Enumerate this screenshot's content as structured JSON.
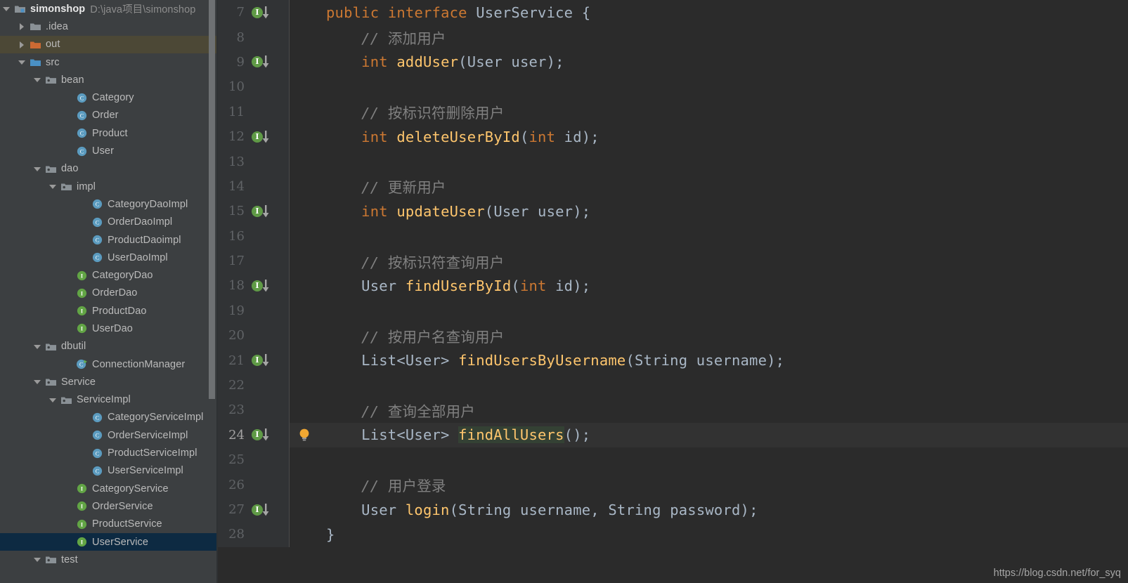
{
  "theme": {
    "sidebar_bg": "#3c3f41",
    "editor_bg": "#2b2b2b",
    "gutter_bg": "#313335",
    "selection_bg": "#0d2a42",
    "hover_bg": "#4c4836",
    "caret_row_bg": "#323232",
    "keyword_color": "#cc7832",
    "method_color": "#ffc66d",
    "type_color": "#a9b7c6",
    "comment_color": "#808080",
    "identifier_highlight_bg": "#344134",
    "impl_marker_green": "#5f9a46",
    "bulb_amber": "#f0a732",
    "interface_icon_green": "#62a545",
    "class_icon_blue": "#5b9bbf",
    "folder_icon_gray": "#8a9196",
    "folder_icon_orange": "#cc6a33",
    "module_icon_blue": "#4a90c4"
  },
  "sidebar": {
    "project_name": "simonshop",
    "project_path": "D:\\java项目\\simonshop",
    "scrollbar": {
      "thumb_top": 0,
      "thumb_height": 568
    },
    "items": [
      {
        "label": "simonshop",
        "path": "D:\\java项目\\simonshop",
        "indent": 0,
        "twisty": "down",
        "icon": "module-icon",
        "state": "normal",
        "bold": true
      },
      {
        "label": ".idea",
        "indent": 1,
        "twisty": "right",
        "icon": "folder-icon",
        "state": "normal"
      },
      {
        "label": "out",
        "indent": 1,
        "twisty": "right",
        "icon": "folder-orange-icon",
        "state": "hover"
      },
      {
        "label": "src",
        "indent": 1,
        "twisty": "down",
        "icon": "folder-source-icon",
        "state": "normal"
      },
      {
        "label": "bean",
        "indent": 2,
        "twisty": "down",
        "icon": "package-icon",
        "state": "normal"
      },
      {
        "label": "Category",
        "indent": 4,
        "twisty": "none",
        "icon": "class-icon",
        "state": "normal"
      },
      {
        "label": "Order",
        "indent": 4,
        "twisty": "none",
        "icon": "class-icon",
        "state": "normal"
      },
      {
        "label": "Product",
        "indent": 4,
        "twisty": "none",
        "icon": "class-icon",
        "state": "normal"
      },
      {
        "label": "User",
        "indent": 4,
        "twisty": "none",
        "icon": "class-icon",
        "state": "normal"
      },
      {
        "label": "dao",
        "indent": 2,
        "twisty": "down",
        "icon": "package-icon",
        "state": "normal"
      },
      {
        "label": "impl",
        "indent": 3,
        "twisty": "down",
        "icon": "package-icon",
        "state": "normal"
      },
      {
        "label": "CategoryDaoImpl",
        "indent": 5,
        "twisty": "none",
        "icon": "class-icon",
        "state": "normal"
      },
      {
        "label": "OrderDaoImpl",
        "indent": 5,
        "twisty": "none",
        "icon": "class-icon",
        "state": "normal"
      },
      {
        "label": "ProductDaoimpl",
        "indent": 5,
        "twisty": "none",
        "icon": "class-icon",
        "state": "normal"
      },
      {
        "label": "UserDaoImpl",
        "indent": 5,
        "twisty": "none",
        "icon": "class-icon",
        "state": "normal"
      },
      {
        "label": "CategoryDao",
        "indent": 4,
        "twisty": "none",
        "icon": "interface-icon",
        "state": "normal"
      },
      {
        "label": "OrderDao",
        "indent": 4,
        "twisty": "none",
        "icon": "interface-icon",
        "state": "normal"
      },
      {
        "label": "ProductDao",
        "indent": 4,
        "twisty": "none",
        "icon": "interface-icon",
        "state": "normal"
      },
      {
        "label": "UserDao",
        "indent": 4,
        "twisty": "none",
        "icon": "interface-icon",
        "state": "normal"
      },
      {
        "label": "dbutil",
        "indent": 2,
        "twisty": "down",
        "icon": "package-icon",
        "state": "normal"
      },
      {
        "label": "ConnectionManager",
        "indent": 4,
        "twisty": "none",
        "icon": "class-runnable-icon",
        "state": "normal"
      },
      {
        "label": "Service",
        "indent": 2,
        "twisty": "down",
        "icon": "package-icon",
        "state": "normal"
      },
      {
        "label": "ServiceImpl",
        "indent": 3,
        "twisty": "down",
        "icon": "package-icon",
        "state": "normal"
      },
      {
        "label": "CategoryServiceImpl",
        "indent": 5,
        "twisty": "none",
        "icon": "class-icon",
        "state": "normal"
      },
      {
        "label": "OrderServiceImpl",
        "indent": 5,
        "twisty": "none",
        "icon": "class-icon",
        "state": "normal"
      },
      {
        "label": "ProductServiceImpl",
        "indent": 5,
        "twisty": "none",
        "icon": "class-icon",
        "state": "normal"
      },
      {
        "label": "UserServiceImpl",
        "indent": 5,
        "twisty": "none",
        "icon": "class-icon",
        "state": "normal"
      },
      {
        "label": "CategoryService",
        "indent": 4,
        "twisty": "none",
        "icon": "interface-icon",
        "state": "normal"
      },
      {
        "label": "OrderService",
        "indent": 4,
        "twisty": "none",
        "icon": "interface-icon",
        "state": "normal"
      },
      {
        "label": "ProductService",
        "indent": 4,
        "twisty": "none",
        "icon": "interface-icon",
        "state": "normal"
      },
      {
        "label": "UserService",
        "indent": 4,
        "twisty": "none",
        "icon": "interface-icon",
        "state": "selected"
      },
      {
        "label": "test",
        "indent": 2,
        "twisty": "down",
        "icon": "package-icon",
        "state": "normal"
      }
    ]
  },
  "editor": {
    "file": "UserService",
    "first_visible_line": 7,
    "caret_line": 24,
    "highlighted_identifier": "findAllUsers",
    "lines": [
      {
        "no": 7,
        "marker": "impl-down",
        "bulb": false,
        "caret": false,
        "tokens": [
          {
            "t": "public",
            "c": "kw"
          },
          {
            "t": " ",
            "c": "pun"
          },
          {
            "t": "interface",
            "c": "kw"
          },
          {
            "t": " ",
            "c": "pun"
          },
          {
            "t": "UserService",
            "c": "typ"
          },
          {
            "t": " {",
            "c": "pun"
          }
        ]
      },
      {
        "no": 8,
        "marker": "none",
        "bulb": false,
        "caret": false,
        "tokens": [
          {
            "t": "    ",
            "c": "pun"
          },
          {
            "t": "// ",
            "c": "cmt"
          },
          {
            "t": "添加用户",
            "c": "cmtc"
          }
        ]
      },
      {
        "no": 9,
        "marker": "impl-down",
        "bulb": false,
        "caret": false,
        "tokens": [
          {
            "t": "    ",
            "c": "pun"
          },
          {
            "t": "int",
            "c": "kw"
          },
          {
            "t": " ",
            "c": "pun"
          },
          {
            "t": "addUser",
            "c": "mth"
          },
          {
            "t": "(",
            "c": "pun"
          },
          {
            "t": "User",
            "c": "typ"
          },
          {
            "t": " user);",
            "c": "pun"
          }
        ]
      },
      {
        "no": 10,
        "marker": "none",
        "bulb": false,
        "caret": false,
        "tokens": []
      },
      {
        "no": 11,
        "marker": "none",
        "bulb": false,
        "caret": false,
        "tokens": [
          {
            "t": "    ",
            "c": "pun"
          },
          {
            "t": "// ",
            "c": "cmt"
          },
          {
            "t": "按标识符删除用户",
            "c": "cmtc"
          }
        ]
      },
      {
        "no": 12,
        "marker": "impl-down",
        "bulb": false,
        "caret": false,
        "tokens": [
          {
            "t": "    ",
            "c": "pun"
          },
          {
            "t": "int",
            "c": "kw"
          },
          {
            "t": " ",
            "c": "pun"
          },
          {
            "t": "deleteUserById",
            "c": "mth"
          },
          {
            "t": "(",
            "c": "pun"
          },
          {
            "t": "int",
            "c": "kw"
          },
          {
            "t": " id);",
            "c": "pun"
          }
        ]
      },
      {
        "no": 13,
        "marker": "none",
        "bulb": false,
        "caret": false,
        "tokens": []
      },
      {
        "no": 14,
        "marker": "none",
        "bulb": false,
        "caret": false,
        "tokens": [
          {
            "t": "    ",
            "c": "pun"
          },
          {
            "t": "// ",
            "c": "cmt"
          },
          {
            "t": "更新用户",
            "c": "cmtc"
          }
        ]
      },
      {
        "no": 15,
        "marker": "impl-down",
        "bulb": false,
        "caret": false,
        "tokens": [
          {
            "t": "    ",
            "c": "pun"
          },
          {
            "t": "int",
            "c": "kw"
          },
          {
            "t": " ",
            "c": "pun"
          },
          {
            "t": "updateUser",
            "c": "mth"
          },
          {
            "t": "(",
            "c": "pun"
          },
          {
            "t": "User",
            "c": "typ"
          },
          {
            "t": " user);",
            "c": "pun"
          }
        ]
      },
      {
        "no": 16,
        "marker": "none",
        "bulb": false,
        "caret": false,
        "tokens": []
      },
      {
        "no": 17,
        "marker": "none",
        "bulb": false,
        "caret": false,
        "tokens": [
          {
            "t": "    ",
            "c": "pun"
          },
          {
            "t": "// ",
            "c": "cmt"
          },
          {
            "t": "按标识符查询用户",
            "c": "cmtc"
          }
        ]
      },
      {
        "no": 18,
        "marker": "impl-down",
        "bulb": false,
        "caret": false,
        "tokens": [
          {
            "t": "    ",
            "c": "pun"
          },
          {
            "t": "User",
            "c": "typ"
          },
          {
            "t": " ",
            "c": "pun"
          },
          {
            "t": "findUserById",
            "c": "mth"
          },
          {
            "t": "(",
            "c": "pun"
          },
          {
            "t": "int",
            "c": "kw"
          },
          {
            "t": " id);",
            "c": "pun"
          }
        ]
      },
      {
        "no": 19,
        "marker": "none",
        "bulb": false,
        "caret": false,
        "tokens": []
      },
      {
        "no": 20,
        "marker": "none",
        "bulb": false,
        "caret": false,
        "tokens": [
          {
            "t": "    ",
            "c": "pun"
          },
          {
            "t": "// ",
            "c": "cmt"
          },
          {
            "t": "按用户名查询用户",
            "c": "cmtc"
          }
        ]
      },
      {
        "no": 21,
        "marker": "impl-down",
        "bulb": false,
        "caret": false,
        "tokens": [
          {
            "t": "    ",
            "c": "pun"
          },
          {
            "t": "List<User>",
            "c": "typ"
          },
          {
            "t": " ",
            "c": "pun"
          },
          {
            "t": "findUsersByUsername",
            "c": "mth"
          },
          {
            "t": "(",
            "c": "pun"
          },
          {
            "t": "String",
            "c": "typ"
          },
          {
            "t": " username);",
            "c": "pun"
          }
        ]
      },
      {
        "no": 22,
        "marker": "none",
        "bulb": false,
        "caret": false,
        "tokens": []
      },
      {
        "no": 23,
        "marker": "none",
        "bulb": false,
        "caret": false,
        "tokens": [
          {
            "t": "    ",
            "c": "pun"
          },
          {
            "t": "// ",
            "c": "cmt"
          },
          {
            "t": "查询全部用户",
            "c": "cmtc"
          }
        ]
      },
      {
        "no": 24,
        "marker": "impl-down",
        "bulb": true,
        "caret": true,
        "tokens": [
          {
            "t": "    ",
            "c": "pun"
          },
          {
            "t": "List<User>",
            "c": "typ"
          },
          {
            "t": " ",
            "c": "pun"
          },
          {
            "t": "findAllUsers",
            "c": "mth idh"
          },
          {
            "t": "();",
            "c": "pun"
          }
        ]
      },
      {
        "no": 25,
        "marker": "none",
        "bulb": false,
        "caret": false,
        "tokens": []
      },
      {
        "no": 26,
        "marker": "none",
        "bulb": false,
        "caret": false,
        "tokens": [
          {
            "t": "    ",
            "c": "pun"
          },
          {
            "t": "// ",
            "c": "cmt"
          },
          {
            "t": "用户登录",
            "c": "cmtc"
          }
        ]
      },
      {
        "no": 27,
        "marker": "impl-down",
        "bulb": false,
        "caret": false,
        "tokens": [
          {
            "t": "    ",
            "c": "pun"
          },
          {
            "t": "User",
            "c": "typ"
          },
          {
            "t": " ",
            "c": "pun"
          },
          {
            "t": "login",
            "c": "mth"
          },
          {
            "t": "(",
            "c": "pun"
          },
          {
            "t": "String",
            "c": "typ"
          },
          {
            "t": " username, ",
            "c": "pun"
          },
          {
            "t": "String",
            "c": "typ"
          },
          {
            "t": " password);",
            "c": "pun"
          }
        ]
      },
      {
        "no": 28,
        "marker": "none",
        "bulb": false,
        "caret": false,
        "tokens": [
          {
            "t": "}",
            "c": "pun"
          }
        ]
      }
    ]
  },
  "watermark": "https://blog.csdn.net/for_syq"
}
